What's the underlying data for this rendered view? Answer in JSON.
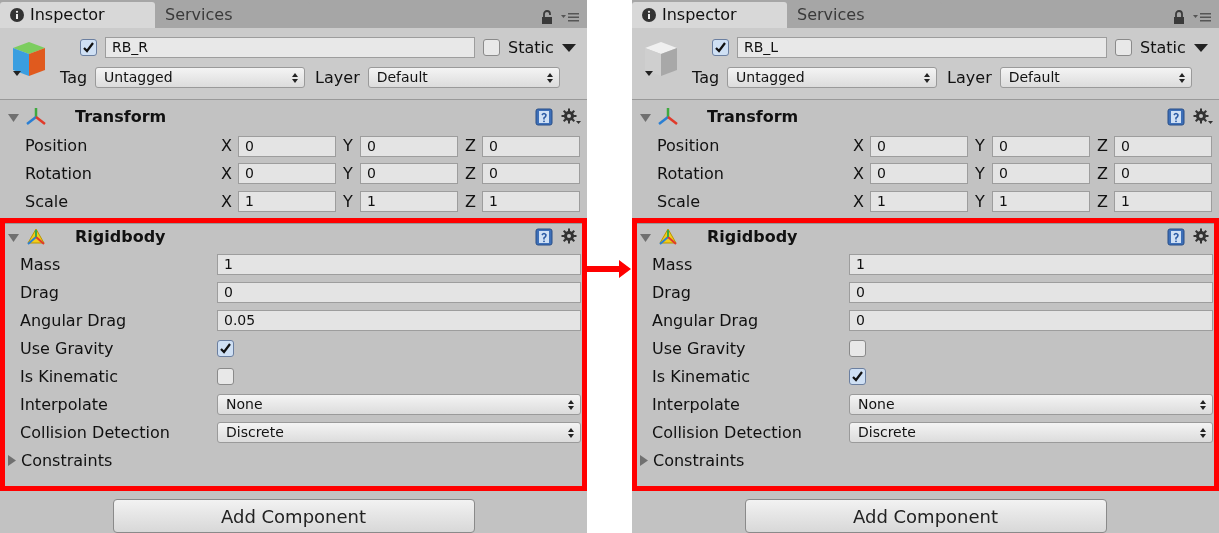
{
  "panels": [
    {
      "tabs": [
        {
          "label": "Inspector",
          "selected": true
        },
        {
          "label": "Services",
          "selected": false
        }
      ],
      "locked": false,
      "object": {
        "prefab": true,
        "active": true,
        "name": "RB_R",
        "static": false,
        "static_label": "Static",
        "tag_label": "Tag",
        "tag": "Untagged",
        "layer_label": "Layer",
        "layer": "Default"
      },
      "transform": {
        "title": "Transform",
        "expanded": true,
        "rows": [
          {
            "label": "Position",
            "fields": [
              {
                "axis": "X",
                "value": "0"
              },
              {
                "axis": "Y",
                "value": "0"
              },
              {
                "axis": "Z",
                "value": "0"
              }
            ]
          },
          {
            "label": "Rotation",
            "fields": [
              {
                "axis": "X",
                "value": "0"
              },
              {
                "axis": "Y",
                "value": "0"
              },
              {
                "axis": "Z",
                "value": "0"
              }
            ]
          },
          {
            "label": "Scale",
            "fields": [
              {
                "axis": "X",
                "value": "1"
              },
              {
                "axis": "Y",
                "value": "1"
              },
              {
                "axis": "Z",
                "value": "1"
              }
            ]
          }
        ]
      },
      "rigidbody": {
        "title": "Rigidbody",
        "expanded": true,
        "highlighted": true,
        "properties": [
          {
            "kind": "number",
            "label": "Mass",
            "value": "1"
          },
          {
            "kind": "number",
            "label": "Drag",
            "value": "0"
          },
          {
            "kind": "number",
            "label": "Angular Drag",
            "value": "0.05"
          },
          {
            "kind": "checkbox",
            "label": "Use Gravity",
            "checked": true
          },
          {
            "kind": "checkbox",
            "label": "Is Kinematic",
            "checked": false
          },
          {
            "kind": "dropdown",
            "label": "Interpolate",
            "value": "None"
          },
          {
            "kind": "dropdown",
            "label": "Collision Detection",
            "value": "Discrete"
          }
        ],
        "constraints": {
          "label": "Constraints",
          "expanded": false
        }
      },
      "add_button": "Add Component"
    },
    {
      "tabs": [
        {
          "label": "Inspector",
          "selected": true
        },
        {
          "label": "Services",
          "selected": false
        }
      ],
      "locked": true,
      "object": {
        "prefab": false,
        "active": true,
        "name": "RB_L",
        "static": false,
        "static_label": "Static",
        "tag_label": "Tag",
        "tag": "Untagged",
        "layer_label": "Layer",
        "layer": "Default"
      },
      "transform": {
        "title": "Transform",
        "expanded": true,
        "rows": [
          {
            "label": "Position",
            "fields": [
              {
                "axis": "X",
                "value": "0"
              },
              {
                "axis": "Y",
                "value": "0"
              },
              {
                "axis": "Z",
                "value": "0"
              }
            ]
          },
          {
            "label": "Rotation",
            "fields": [
              {
                "axis": "X",
                "value": "0"
              },
              {
                "axis": "Y",
                "value": "0"
              },
              {
                "axis": "Z",
                "value": "0"
              }
            ]
          },
          {
            "label": "Scale",
            "fields": [
              {
                "axis": "X",
                "value": "1"
              },
              {
                "axis": "Y",
                "value": "1"
              },
              {
                "axis": "Z",
                "value": "1"
              }
            ]
          }
        ]
      },
      "rigidbody": {
        "title": "Rigidbody",
        "expanded": true,
        "highlighted": true,
        "properties": [
          {
            "kind": "number",
            "label": "Mass",
            "value": "1"
          },
          {
            "kind": "number",
            "label": "Drag",
            "value": "0"
          },
          {
            "kind": "number",
            "label": "Angular Drag",
            "value": "0"
          },
          {
            "kind": "checkbox",
            "label": "Use Gravity",
            "checked": false
          },
          {
            "kind": "checkbox",
            "label": "Is Kinematic",
            "checked": true
          },
          {
            "kind": "dropdown",
            "label": "Interpolate",
            "value": "None"
          },
          {
            "kind": "dropdown",
            "label": "Collision Detection",
            "value": "Discrete"
          }
        ],
        "constraints": {
          "label": "Constraints",
          "expanded": false
        }
      },
      "add_button": "Add Component"
    }
  ]
}
